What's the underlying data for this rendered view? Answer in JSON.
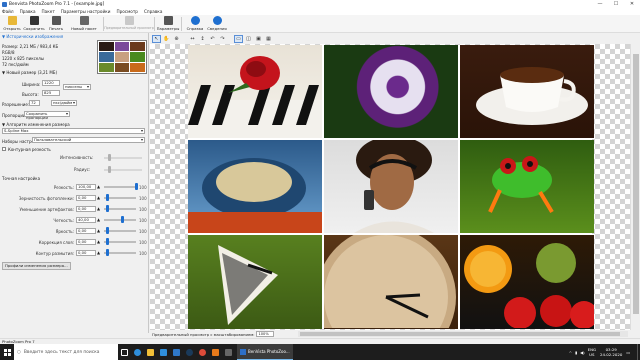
{
  "window": {
    "title": "Benvista PhotoZoom Pro 7.1 - [example.jpg]",
    "controls": [
      "—",
      "☐",
      "✕"
    ]
  },
  "menu": [
    "Файл",
    "Правка",
    "Пакет",
    "Параметры настройки",
    "Просмотр",
    "Справка"
  ],
  "toolbar": {
    "open": "Открыть",
    "save": "Сохранить",
    "print": "Печать",
    "new_batch": "Новый пакет",
    "preview": "Предварительный просмотр",
    "settings": "Параметры",
    "help": "Справка",
    "about": "Сведения"
  },
  "left": {
    "image_info": {
      "size": "Размер: 2,21 МБ / 983,4 КБ",
      "mode": "RGB/8",
      "pixels": "1220 x 825 пикселы",
      "dpi": "72 пкс/дюйм"
    },
    "section_history": "Исторически изображения",
    "section_new_size": "Новый размер (3,21 МБ)",
    "width_label": "Ширина:",
    "width_value": "1220",
    "height_label": "Высота:",
    "height_value": "825",
    "res_label": "Разрешение:",
    "res_value": "72",
    "unit_pixels": "пикселы",
    "unit_dpi": "пкс/дюйм",
    "proportions_label": "Пропорции:",
    "proportions_value": "Сохранить пропорции",
    "section_resize_algo": "Алгоритм изменения размера",
    "algo_value": "S-Spline Max",
    "presets_label": "Наборы настроек:",
    "presets_value": "Пользовательский",
    "contour_label": "Контурная резкость",
    "intensity_label": "Интенсивность:",
    "radius_label": "Радиус:",
    "section_fine": "Точная настройка",
    "fine": [
      {
        "label": "Резкость:",
        "value": "100,00",
        "max": "100"
      },
      {
        "label": "Зернистость фотопленки:",
        "value": "0,00",
        "max": "100"
      },
      {
        "label": "Уменьшение артефактов:",
        "value": "0,00",
        "max": "100"
      },
      {
        "label": "Четкость:",
        "value": "40,00",
        "max": "100"
      },
      {
        "label": "Яркость:",
        "value": "0,00",
        "max": "100"
      },
      {
        "label": "Коррекция слоя:",
        "value": "0,00",
        "max": "100"
      },
      {
        "label": "Контур размытия:",
        "value": "0,00",
        "max": "100"
      }
    ],
    "profiles_button": "Профили изменения размера..."
  },
  "bottom": {
    "preview_label": "Предварительный просмотр с масштабированием:",
    "zoom": "100%"
  },
  "status": "PhotoZoom Pro 7",
  "taskbar": {
    "search_placeholder": "Введите здесь текст для поиска",
    "active_app": "BenVista PhotoZoo...",
    "lang": "ENG",
    "lang2": "US",
    "time": "03:29",
    "date": "24.02.2020"
  },
  "colors": {
    "accent": "#1e6fd0",
    "taskbar": "#1d1d1d"
  }
}
